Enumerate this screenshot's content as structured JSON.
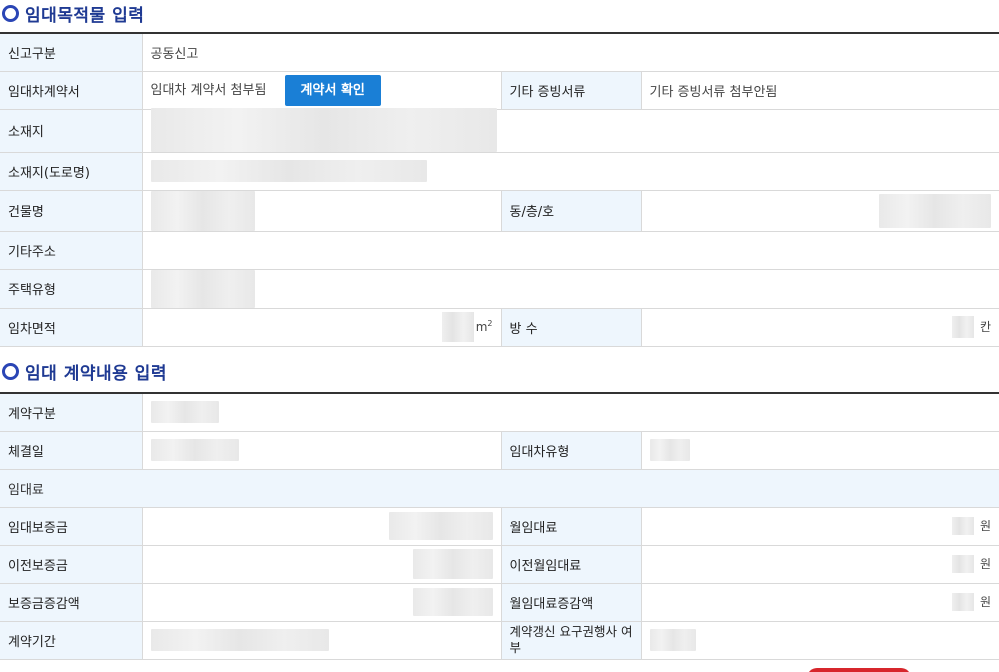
{
  "section1": {
    "title": "임대목적물 입력",
    "rows": {
      "report_type_label": "신고구분",
      "report_type_value": "공동신고",
      "contract_doc_label": "임대차계약서",
      "contract_doc_value": "임대차 계약서 첨부됨",
      "contract_confirm_button": "계약서 확인",
      "other_docs_label": "기타 증빙서류",
      "other_docs_value": "기타 증빙서류 첨부안됨",
      "location_label": "소재지",
      "location_road_label": "소재지(도로명)",
      "building_label": "건물명",
      "dong_floor_ho_label": "동/층/호",
      "other_address_label": "기타주소",
      "housing_type_label": "주택유형",
      "area_label": "임차면적",
      "area_unit": "m",
      "area_unit_sup": "2",
      "rooms_label": "방 수",
      "rooms_unit": "칸"
    }
  },
  "section2": {
    "title": "임대 계약내용 입력",
    "rows": {
      "contract_type_label": "계약구분",
      "signed_date_label": "체결일",
      "lease_type_label": "임대차유형",
      "rent_label": "임대료",
      "deposit_label": "임대보증금",
      "monthly_rent_label": "월임대료",
      "monthly_rent_unit": "원",
      "prev_deposit_label": "이전보증금",
      "prev_monthly_label": "이전월임대료",
      "prev_monthly_unit": "원",
      "deposit_change_label": "보증금증감액",
      "monthly_change_label": "월임대료증감액",
      "monthly_change_unit": "원",
      "period_label": "계약기간",
      "renewal_label": "계약갱신 요구권행사 여부"
    }
  }
}
